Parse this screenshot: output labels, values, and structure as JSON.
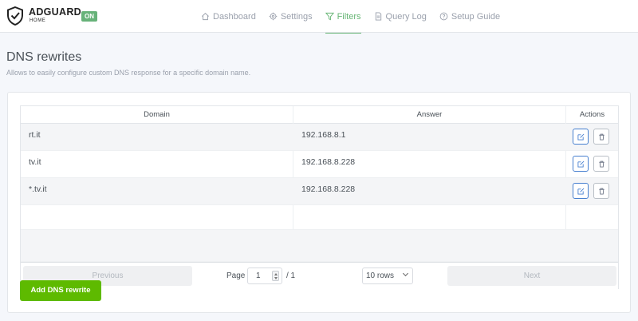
{
  "header": {
    "logo_main": "ADGUARD",
    "logo_sub": "HOME",
    "status_badge": "ON",
    "nav": [
      {
        "label": "Dashboard",
        "icon": "home-icon"
      },
      {
        "label": "Settings",
        "icon": "gear-icon"
      },
      {
        "label": "Filters",
        "icon": "filter-icon",
        "active": true
      },
      {
        "label": "Query Log",
        "icon": "document-icon"
      },
      {
        "label": "Setup Guide",
        "icon": "help-circle-icon"
      }
    ]
  },
  "page": {
    "title": "DNS rewrites",
    "description": "Allows to easily configure custom DNS response for a specific domain name."
  },
  "table": {
    "columns": [
      "Domain",
      "Answer",
      "Actions"
    ],
    "rows": [
      {
        "domain": "rt.it",
        "answer": "192.168.8.1"
      },
      {
        "domain": "tv.it",
        "answer": "192.168.8.228"
      },
      {
        "domain": "*.tv.it",
        "answer": "192.168.8.228"
      }
    ]
  },
  "pagination": {
    "previous": "Previous",
    "next": "Next",
    "page_label": "Page",
    "page_value": "1",
    "of_label": "/ 1",
    "rows_select": "10 rows"
  },
  "actions": {
    "add_label": "Add DNS rewrite"
  },
  "colors": {
    "accent": "#66b574",
    "add_button": "#5eba00",
    "edit_border": "#467fcf"
  }
}
